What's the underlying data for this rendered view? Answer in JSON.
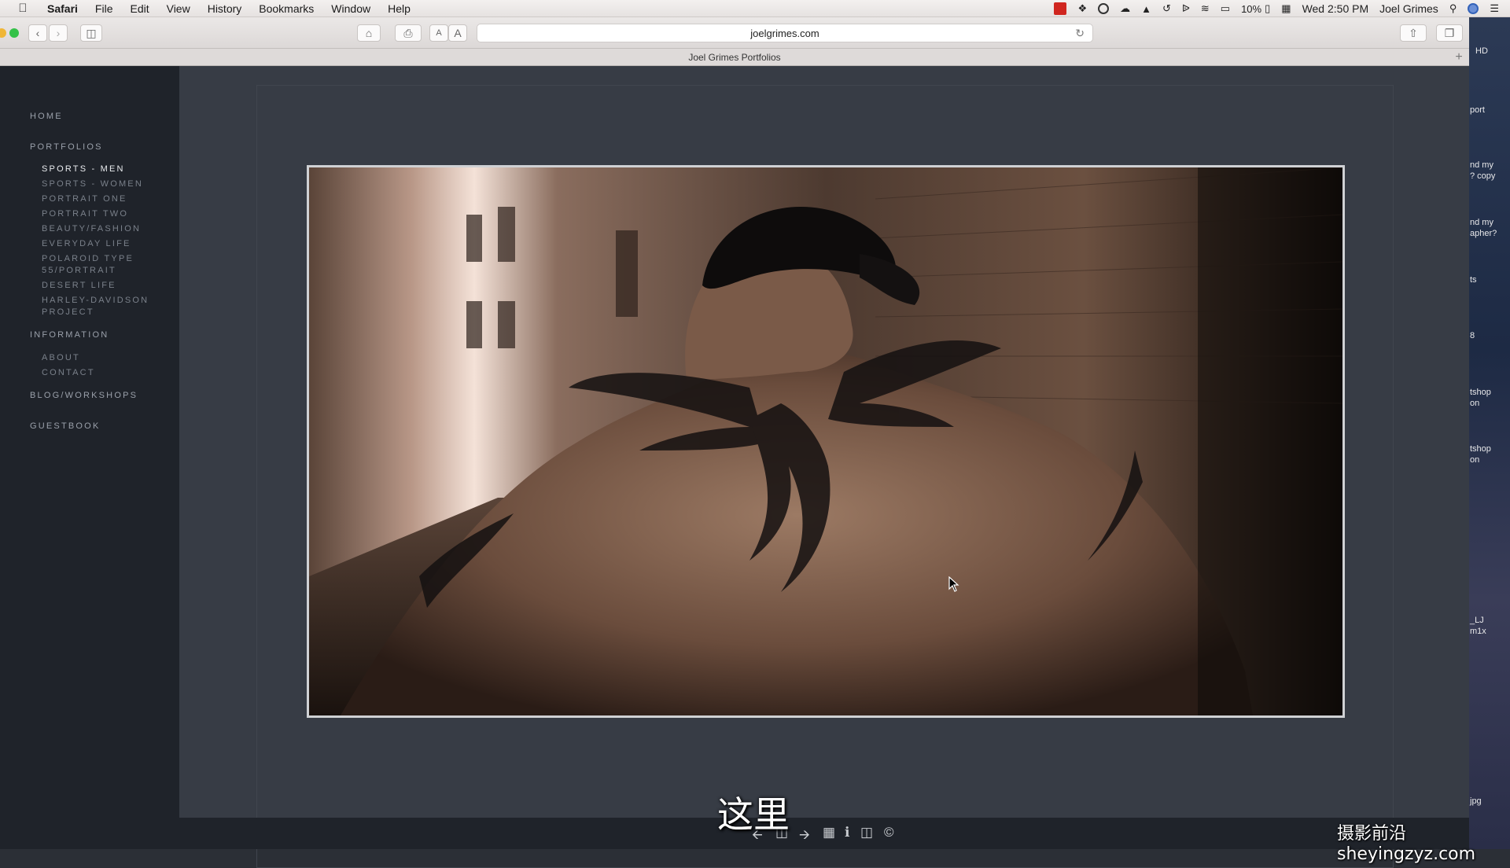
{
  "menubar": {
    "app_name": "Safari",
    "items": [
      "File",
      "Edit",
      "View",
      "History",
      "Bookmarks",
      "Window",
      "Help"
    ],
    "battery": "10%",
    "clock": "Wed 2:50 PM",
    "user": "Joel Grimes"
  },
  "browser": {
    "url": "joelgrimes.com",
    "tab_title": "Joel Grimes Portfolios"
  },
  "sidebar": {
    "home": "HOME",
    "portfolios": "PORTFOLIOS",
    "portfolio_items": [
      "SPORTS - MEN",
      "SPORTS - WOMEN",
      "PORTRAIT ONE",
      "PORTRAIT TWO",
      "BEAUTY/FASHION",
      "EVERYDAY LIFE",
      "POLAROID TYPE 55/PORTRAIT",
      "DESERT LIFE",
      "HARLEY-DAVIDSON PROJECT"
    ],
    "information": "INFORMATION",
    "information_items": [
      "ABOUT",
      "CONTACT"
    ],
    "blog": "BLOG/WORKSHOPS",
    "guestbook": "GUESTBOOK"
  },
  "desktop_labels": [
    "HD",
    "port",
    "nd my\n? copy",
    "nd my\napher?",
    "ts",
    "8",
    "tshop\non",
    "tshop\non",
    "_LJ\nm1x",
    "jpg"
  ],
  "subtitle": "这里",
  "watermark": "摄影前沿 sheyingzyz.com"
}
